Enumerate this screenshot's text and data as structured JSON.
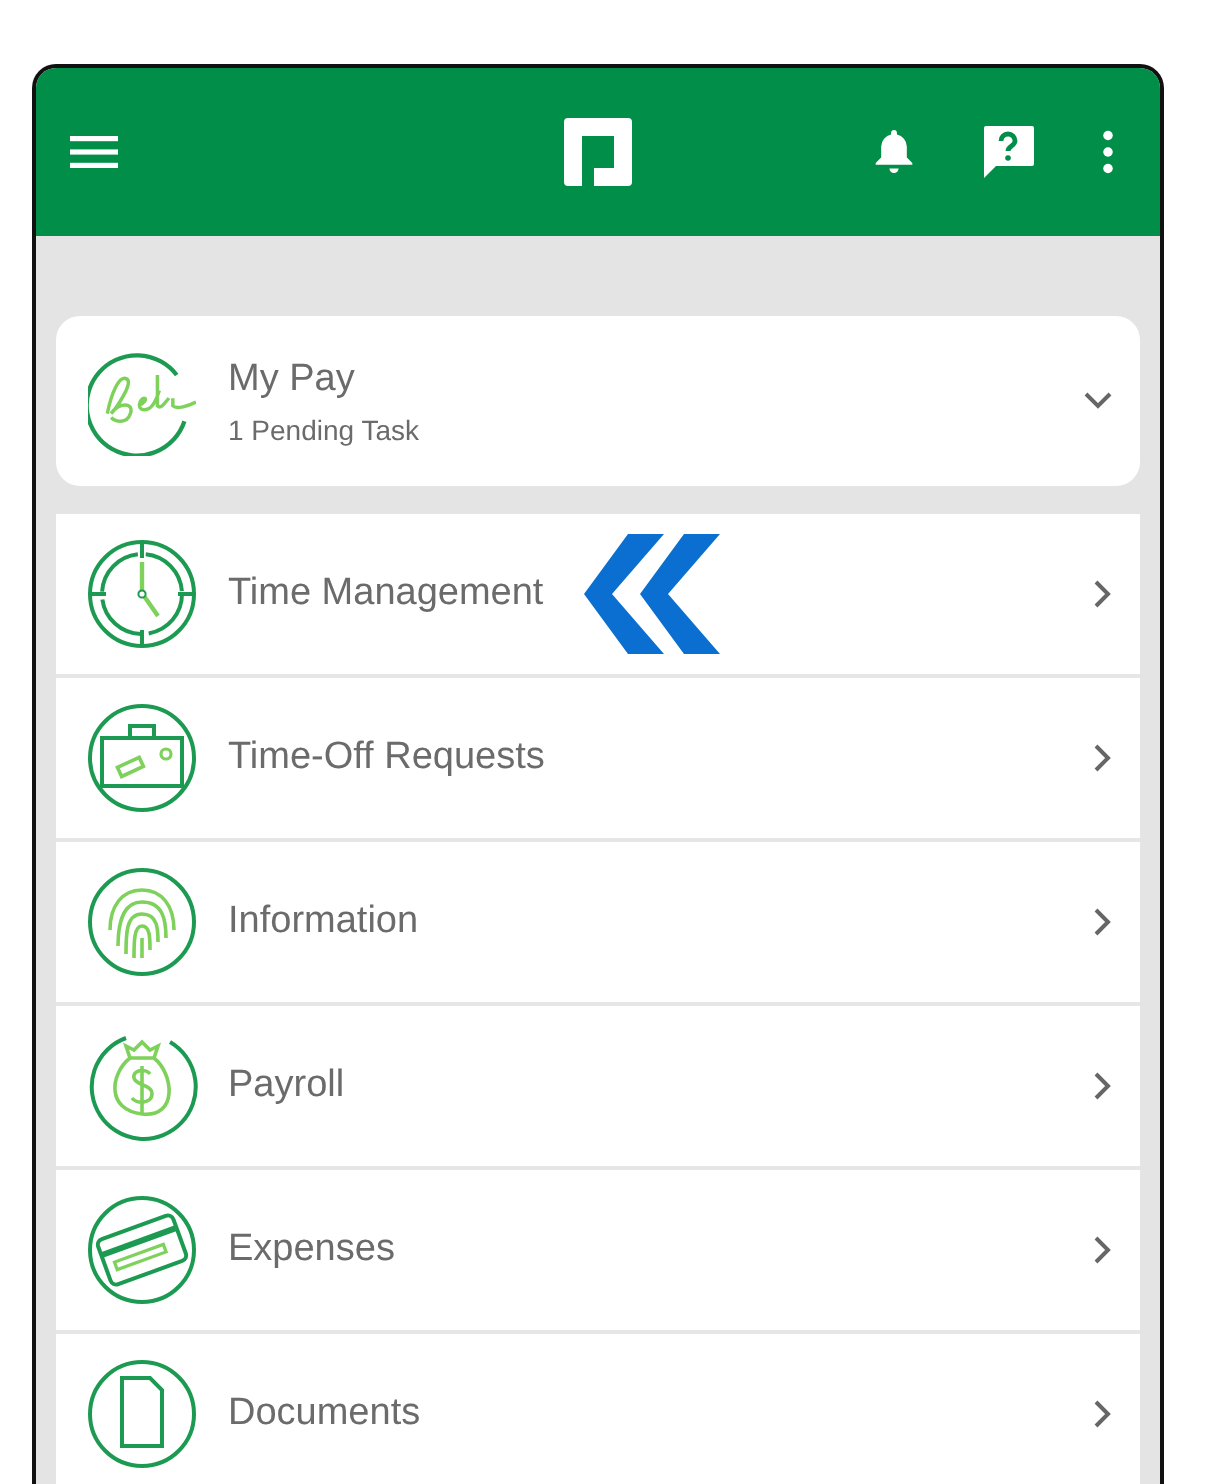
{
  "my_pay": {
    "title": "My Pay",
    "subtitle": "1 Pending Task",
    "expanded": false
  },
  "menu": [
    {
      "kind": "clock",
      "label": "Time Management",
      "pointer": true
    },
    {
      "kind": "briefcase",
      "label": "Time-Off Requests",
      "pointer": false
    },
    {
      "kind": "fingerprint",
      "label": "Information",
      "pointer": false
    },
    {
      "kind": "moneybag",
      "label": "Payroll",
      "pointer": false
    },
    {
      "kind": "card",
      "label": "Expenses",
      "pointer": false
    },
    {
      "kind": "document",
      "label": "Documents",
      "pointer": false
    }
  ]
}
